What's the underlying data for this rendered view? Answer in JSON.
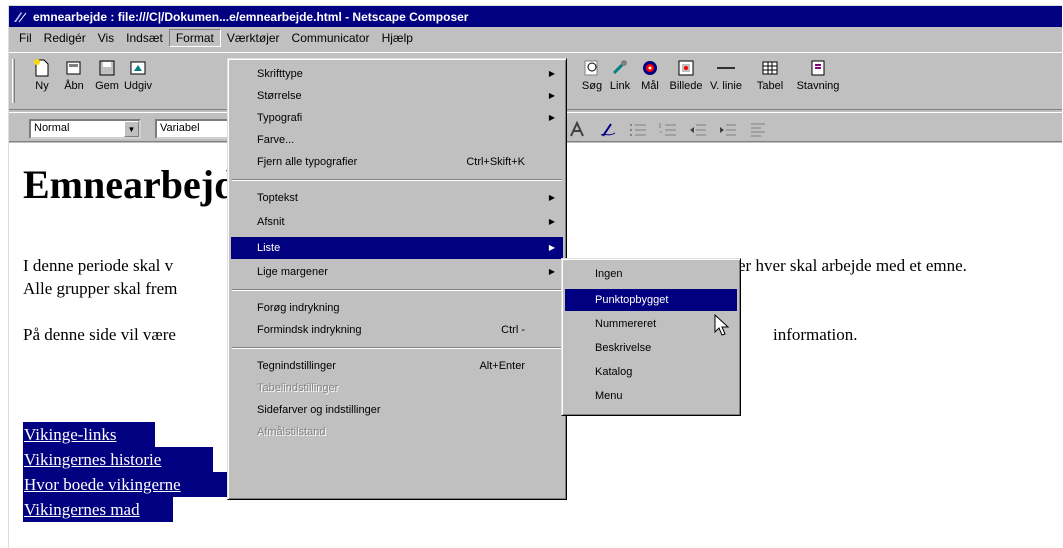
{
  "window": {
    "title": "emnearbejde : file:///C|/Dokumen...e/emnearbejde.html - Netscape Composer"
  },
  "menubar": [
    "Fil",
    "Redigér",
    "Vis",
    "Indsæt",
    "Format",
    "Værktøjer",
    "Communicator",
    "Hjælp"
  ],
  "toolbar": {
    "buttons": [
      "Ny",
      "Åbn",
      "Gem",
      "Udgiv",
      "Søg",
      "Link",
      "Mål",
      "Billede",
      "V. linie",
      "Tabel",
      "Stavning"
    ]
  },
  "format_bar": {
    "style_value": "Normal",
    "font_value": "Variabel"
  },
  "document": {
    "heading": "Emnearbejde",
    "para1_left": "I denne periode skal v",
    "para1_right": "er hver skal arbejde med et emne.",
    "para2": "Alle grupper skal frem",
    "para3_left": "På denne side vil være",
    "para3_right": "information.",
    "links": [
      "Vikinge-links",
      "Vikingernes historie",
      "Hvor boede vikingerne",
      "Vikingernes mad"
    ]
  },
  "format_menu": {
    "items": [
      {
        "label": "Skrifttype",
        "submenu": true
      },
      {
        "label": "Størrelse",
        "submenu": true
      },
      {
        "label": "Typografi",
        "submenu": true
      },
      {
        "label": "Farve..."
      },
      {
        "label": "Fjern alle typografier",
        "shortcut": "Ctrl+Skift+K"
      },
      {
        "label": "Toptekst",
        "submenu": true
      },
      {
        "label": "Afsnit",
        "submenu": true
      },
      {
        "label": "Liste",
        "submenu": true
      },
      {
        "label": "Lige margener",
        "submenu": true
      },
      {
        "label": "Forøg indrykning"
      },
      {
        "label": "Formindsk indrykning",
        "shortcut": "Ctrl -"
      },
      {
        "label": "Tegnindstillinger",
        "shortcut": "Alt+Enter"
      },
      {
        "label": "Tabelindstillinger",
        "disabled": true
      },
      {
        "label": "Sidefarver og indstillinger"
      },
      {
        "label": "Afmålstilstand",
        "disabled": true
      }
    ]
  },
  "list_submenu": {
    "items": [
      "Ingen",
      "Punktopbygget",
      "Nummereret",
      "Beskrivelse",
      "Katalog",
      "Menu"
    ],
    "selected": "Punktopbygget"
  },
  "colors": {
    "titlebar": "#000080",
    "face": "#c0c0c0",
    "highlight": "#000080"
  }
}
